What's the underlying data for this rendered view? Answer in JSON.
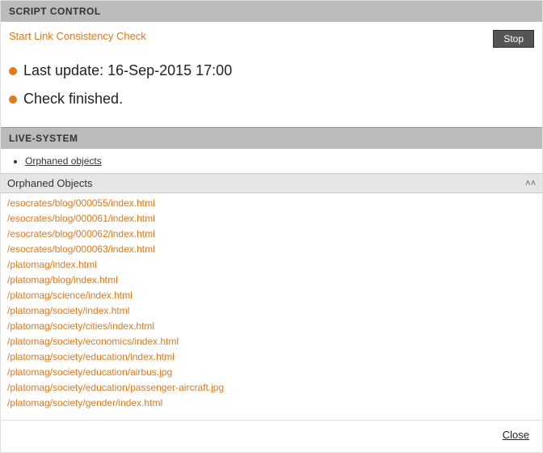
{
  "script_control": {
    "header": "SCRIPT CONTROL",
    "start_link": "Start Link Consistency Check",
    "stop_button": "Stop",
    "status_update": "Last update: 16-Sep-2015 17:00",
    "status_finished": "Check finished."
  },
  "live_system": {
    "header": "LIVE-SYSTEM",
    "nav_item": "Orphaned objects",
    "table_title": "Orphaned Objects",
    "objects": [
      "/esocrates/blog/000055/index.html",
      "/esocrates/blog/000061/index.html",
      "/esocrates/blog/000062/index.html",
      "/esocrates/blog/000063/index.html",
      "/platomag/index.html",
      "/platomag/blog/index.html",
      "/platomag/science/index.html",
      "/platomag/society/index.html",
      "/platomag/society/cities/index.html",
      "/platomag/society/economics/index.html",
      "/platomag/society/education/index.html",
      "/platomag/society/education/airbus.jpg",
      "/platomag/society/education/passenger-aircraft.jpg",
      "/platomag/society/gender/index.html"
    ]
  },
  "footer": {
    "close": "Close"
  }
}
